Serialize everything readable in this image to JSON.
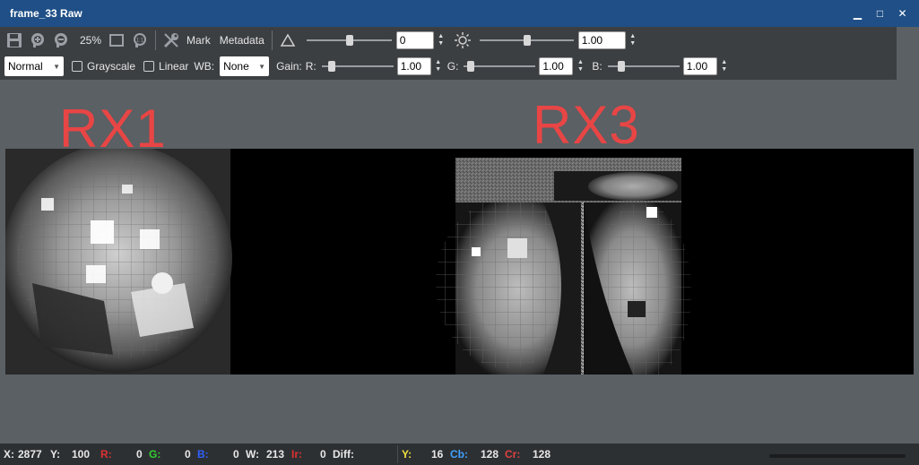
{
  "window": {
    "title": "frame_33 Raw",
    "minimize_glyph": "▁",
    "maximize_glyph": "□",
    "close_glyph": "✕"
  },
  "toolbar": {
    "zoom_label": "25%",
    "mark_label": "Mark",
    "metadata_label": "Metadata",
    "contrast_value": "0",
    "brightness_value": "1.00",
    "contrast_slider_level": 0.5,
    "brightness_slider_level": 0.5
  },
  "toolbar2": {
    "mode_selected": "Normal",
    "grayscale_label": "Grayscale",
    "linear_label": "Linear",
    "wb_label": "WB:",
    "wb_selected": "None",
    "gain_label": "Gain:",
    "r_label": "R:",
    "r_value": "1.00",
    "g_label": "G:",
    "g_value": "1.00",
    "b_label": "B:",
    "b_value": "1.00",
    "r_slider_level": 0.1,
    "g_slider_level": 0.05,
    "b_slider_level": 0.15
  },
  "viewer": {
    "label_left": "RX1",
    "label_right": "RX3"
  },
  "status": {
    "x_label": "X:",
    "x_value": "2877",
    "y_label": "Y:",
    "y_value": "100",
    "r_label": "R:",
    "r_value": "0",
    "g_label": "G:",
    "g_value": "0",
    "b_label": "B:",
    "b_value": "0",
    "w_label": "W:",
    "w_value": "213",
    "ir_label": "Ir:",
    "ir_value": "0",
    "diff_label": "Diff:",
    "yy_label": "Y:",
    "yy_value": "16",
    "cb_label": "Cb:",
    "cb_value": "128",
    "cr_label": "Cr:",
    "cr_value": "128"
  },
  "colors": {
    "titlebar": "#1f4f86",
    "toolbar": "#3c3f42",
    "overlay_text": "#e84545",
    "status_r": "#e03030",
    "status_g": "#30d030",
    "status_b": "#3060ff",
    "status_y": "#f0e040",
    "status_cb": "#3fa0ff",
    "status_cr": "#e04040"
  },
  "icons": [
    "save-icon",
    "zoom-in-icon",
    "zoom-out-icon",
    "fit-window-icon",
    "actual-size-icon",
    "tools-icon",
    "contrast-icon",
    "brightness-icon"
  ]
}
